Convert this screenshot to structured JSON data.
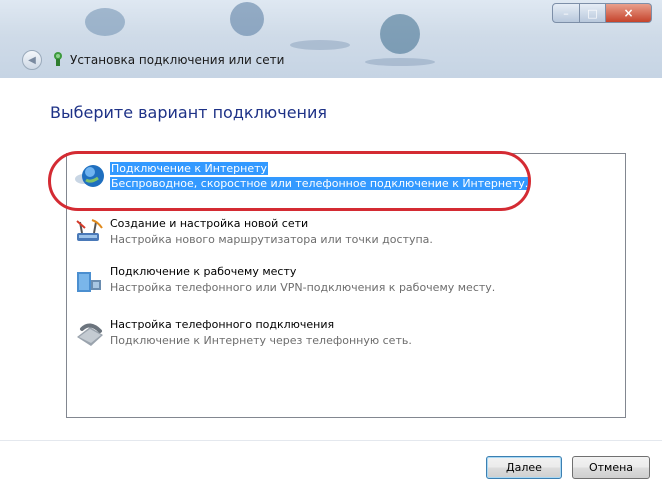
{
  "window": {
    "title": "Установка подключения или сети",
    "controls": {
      "minimize": "–",
      "maximize": "□",
      "close": "×"
    }
  },
  "main": {
    "heading": "Выберите вариант подключения",
    "options": [
      {
        "title": "Подключение к Интернету",
        "description": "Беспроводное, скоростное или телефонное подключение к Интернету.",
        "icon": "globe-icon",
        "selected": true
      },
      {
        "title": "Создание и настройка новой сети",
        "description": "Настройка нового маршрутизатора или точки доступа.",
        "icon": "network-setup-icon",
        "selected": false
      },
      {
        "title": "Подключение к рабочему месту",
        "description": "Настройка телефонного или VPN-подключения к рабочему месту.",
        "icon": "workplace-icon",
        "selected": false
      },
      {
        "title": "Настройка телефонного подключения",
        "description": "Подключение к Интернету через телефонную сеть.",
        "icon": "phone-icon",
        "selected": false
      }
    ]
  },
  "buttons": {
    "next": "Далее",
    "cancel": "Отмена"
  },
  "colors": {
    "selection": "#3399ff",
    "heading": "#1e3287",
    "highlight_oval": "#d42b33"
  }
}
